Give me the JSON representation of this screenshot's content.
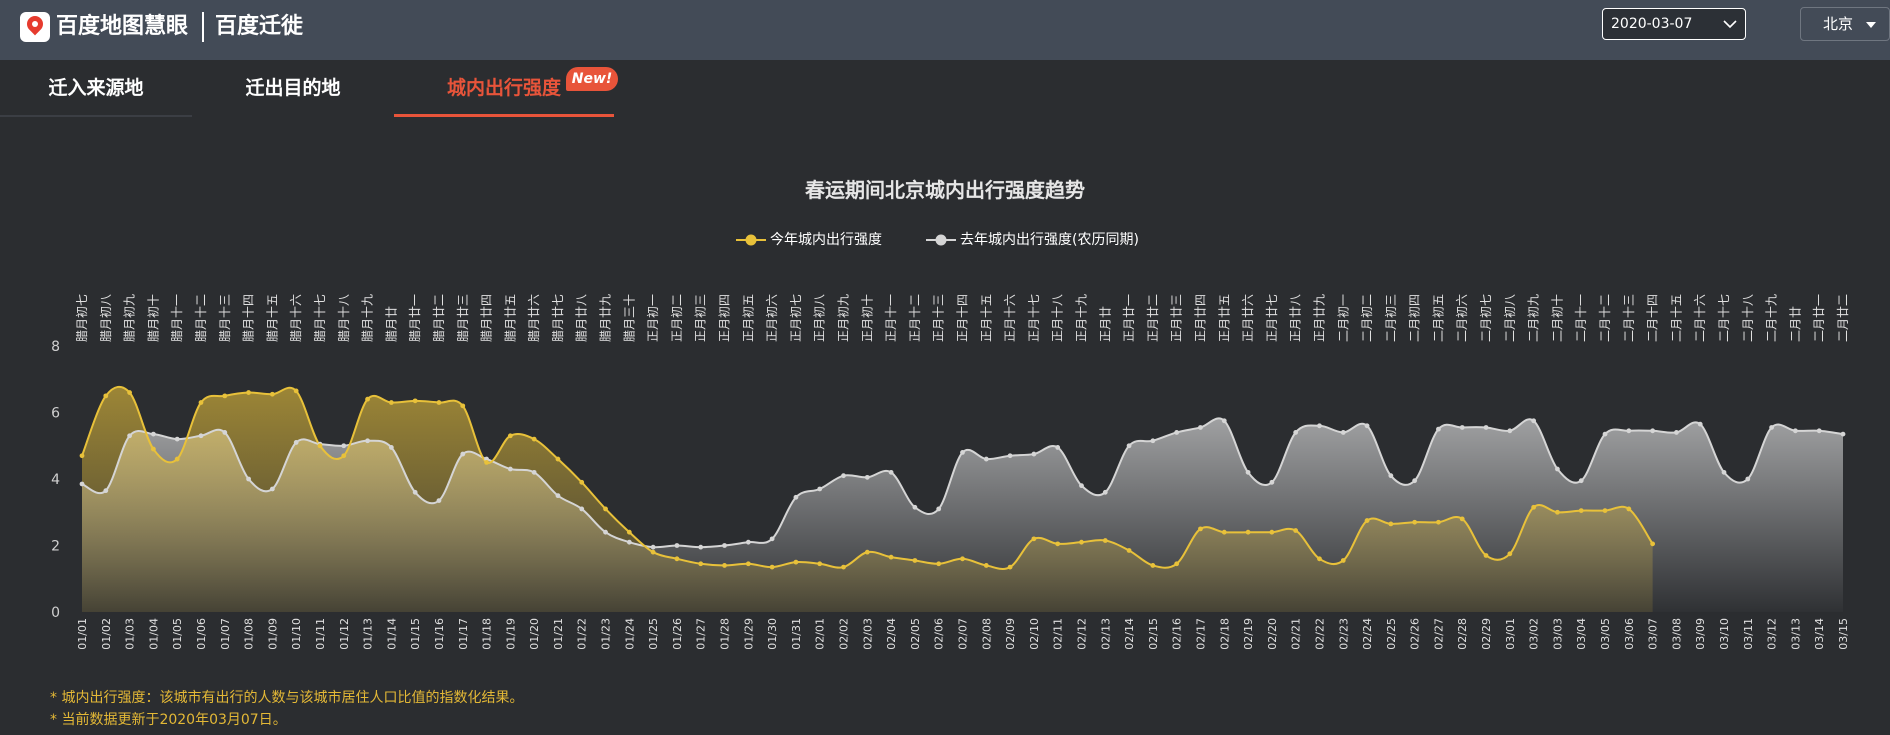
{
  "header": {
    "logo_text": "百度地图慧眼",
    "product_title": "百度迁徙",
    "date_value": "2020-03-07",
    "city_value": "北京"
  },
  "tabs": [
    {
      "label": "迁入来源地",
      "active": false
    },
    {
      "label": "迁出目的地",
      "active": false
    },
    {
      "label": "城内出行强度",
      "active": true
    }
  ],
  "badge": "New!",
  "footnotes": [
    "* 城内出行强度：该城市有出行的人数与该城市居住人口比值的指数化结果。",
    "* 当前数据更新于2020年03月07日。"
  ],
  "colors": {
    "header_bg": "#434b57",
    "page_bg": "#2b2d30",
    "accent": "#e8543a",
    "series_this_year": "#e8c13a",
    "series_last_year": "#d5d5d5",
    "footnote": "#e3b836"
  },
  "chart_data": {
    "type": "area",
    "title": "春运期间北京城内出行强度趋势",
    "ylim": [
      0,
      8
    ],
    "yticks": [
      0,
      2,
      4,
      6,
      8
    ],
    "grid": false,
    "legend_position": "top-center",
    "x": [
      "01/01",
      "01/02",
      "01/03",
      "01/04",
      "01/05",
      "01/06",
      "01/07",
      "01/08",
      "01/09",
      "01/10",
      "01/11",
      "01/12",
      "01/13",
      "01/14",
      "01/15",
      "01/16",
      "01/17",
      "01/18",
      "01/19",
      "01/20",
      "01/21",
      "01/22",
      "01/23",
      "01/24",
      "01/25",
      "01/26",
      "01/27",
      "01/28",
      "01/29",
      "01/30",
      "01/31",
      "02/01",
      "02/02",
      "02/03",
      "02/04",
      "02/05",
      "02/06",
      "02/07",
      "02/08",
      "02/09",
      "02/10",
      "02/11",
      "02/12",
      "02/13",
      "02/14",
      "02/15",
      "02/16",
      "02/17",
      "02/18",
      "02/19",
      "02/20",
      "02/21",
      "02/22",
      "02/23",
      "02/24",
      "02/25",
      "02/26",
      "02/27",
      "02/28",
      "02/29",
      "03/01",
      "03/02",
      "03/03",
      "03/04",
      "03/05",
      "03/06",
      "03/07",
      "03/08",
      "03/09",
      "03/10",
      "03/11",
      "03/12",
      "03/13",
      "03/14",
      "03/15"
    ],
    "x2": [
      "腊月初七",
      "腊月初八",
      "腊月初九",
      "腊月初十",
      "腊月十一",
      "腊月十二",
      "腊月十三",
      "腊月十四",
      "腊月十五",
      "腊月十六",
      "腊月十七",
      "腊月十八",
      "腊月十九",
      "腊月廿",
      "腊月廿一",
      "腊月廿二",
      "腊月廿三",
      "腊月廿四",
      "腊月廿五",
      "腊月廿六",
      "腊月廿七",
      "腊月廿八",
      "腊月廿九",
      "腊月三十",
      "正月初一",
      "正月初二",
      "正月初三",
      "正月初四",
      "正月初五",
      "正月初六",
      "正月初七",
      "正月初八",
      "正月初九",
      "正月初十",
      "正月十一",
      "正月十二",
      "正月十三",
      "正月十四",
      "正月十五",
      "正月十六",
      "正月十七",
      "正月十八",
      "正月十九",
      "正月廿",
      "正月廿一",
      "正月廿二",
      "正月廿三",
      "正月廿四",
      "正月廿五",
      "正月廿六",
      "正月廿七",
      "正月廿八",
      "正月廿九",
      "二月初一",
      "二月初二",
      "二月初三",
      "二月初四",
      "二月初五",
      "二月初六",
      "二月初七",
      "二月初八",
      "二月初九",
      "二月初十",
      "二月十一",
      "二月十二",
      "二月十三",
      "二月十四",
      "二月十五",
      "二月十六",
      "二月十七",
      "二月十八",
      "二月十九",
      "二月廿",
      "二月廿一",
      "二月廿二"
    ],
    "series": [
      {
        "name": "今年城内出行强度",
        "values": [
          4.7,
          6.5,
          6.6,
          4.9,
          4.6,
          6.3,
          6.5,
          6.6,
          6.55,
          6.65,
          5.0,
          4.7,
          6.4,
          6.3,
          6.35,
          6.3,
          6.2,
          4.5,
          5.3,
          5.2,
          4.6,
          3.9,
          3.1,
          2.4,
          1.8,
          1.6,
          1.45,
          1.4,
          1.45,
          1.35,
          1.5,
          1.45,
          1.35,
          1.8,
          1.65,
          1.55,
          1.45,
          1.6,
          1.4,
          1.35,
          2.2,
          2.05,
          2.1,
          2.15,
          1.85,
          1.4,
          1.45,
          2.5,
          2.4,
          2.4,
          2.4,
          2.45,
          1.6,
          1.55,
          2.75,
          2.65,
          2.7,
          2.7,
          2.8,
          1.7,
          1.75,
          3.15,
          3.0,
          3.05,
          3.05,
          3.1,
          2.05
        ],
        "color": "#e8c13a"
      },
      {
        "name": "去年城内出行强度(农历同期)",
        "values": [
          3.85,
          3.65,
          5.3,
          5.35,
          5.2,
          5.3,
          5.4,
          4.0,
          3.7,
          5.1,
          5.05,
          5.0,
          5.15,
          4.95,
          3.6,
          3.35,
          4.75,
          4.6,
          4.3,
          4.2,
          3.5,
          3.1,
          2.4,
          2.1,
          1.95,
          2.0,
          1.95,
          2.0,
          2.1,
          2.2,
          3.45,
          3.7,
          4.1,
          4.05,
          4.2,
          3.15,
          3.1,
          4.8,
          4.6,
          4.7,
          4.75,
          4.95,
          3.8,
          3.6,
          5.0,
          5.15,
          5.4,
          5.55,
          5.75,
          4.2,
          3.9,
          5.4,
          5.6,
          5.4,
          5.6,
          4.1,
          3.95,
          5.5,
          5.55,
          5.55,
          5.45,
          5.75,
          4.3,
          3.95,
          5.35,
          5.45,
          5.45,
          5.4,
          5.65,
          4.2,
          4.0,
          5.55,
          5.45,
          5.45,
          5.35
        ],
        "color": "#d5d5d5"
      }
    ]
  }
}
